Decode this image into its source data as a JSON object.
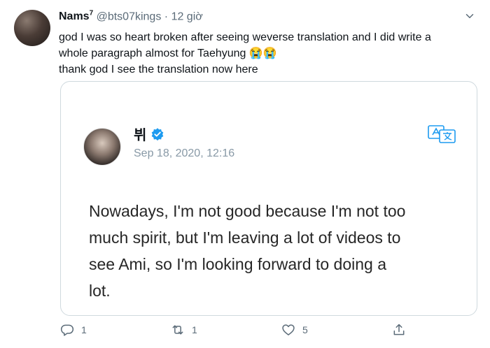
{
  "tweet": {
    "author_name": "Nams",
    "author_superscript": "7",
    "handle": "@bts07kings",
    "separator": "·",
    "time": "12 giờ",
    "lines": [
      "god I was so heart broken after seeing weverse translation and I did write a",
      "whole paragraph almost for Taehyung 😭😭",
      "thank god I see the translation now here"
    ]
  },
  "quote": {
    "name": "뷔",
    "timestamp": "Sep 18, 2020, 12:16",
    "body_lines": [
      "Nowadays, I'm not good because I'm not too",
      "much spirit, but I'm leaving a lot of videos to",
      "see Ami, so I'm looking forward to doing a",
      "lot."
    ]
  },
  "actions": {
    "reply_count": "1",
    "retweet_count": "1",
    "like_count": "5"
  },
  "icons": {
    "reply": "reply-icon",
    "retweet": "retweet-icon",
    "like": "heart-icon",
    "share": "share-icon",
    "verified": "verified-badge-icon",
    "translate": "translate-icon",
    "more": "chevron-down-icon"
  },
  "colors": {
    "verified_blue": "#1d9bf0",
    "muted_text": "#5b6b78",
    "card_border": "#cfd9de"
  }
}
